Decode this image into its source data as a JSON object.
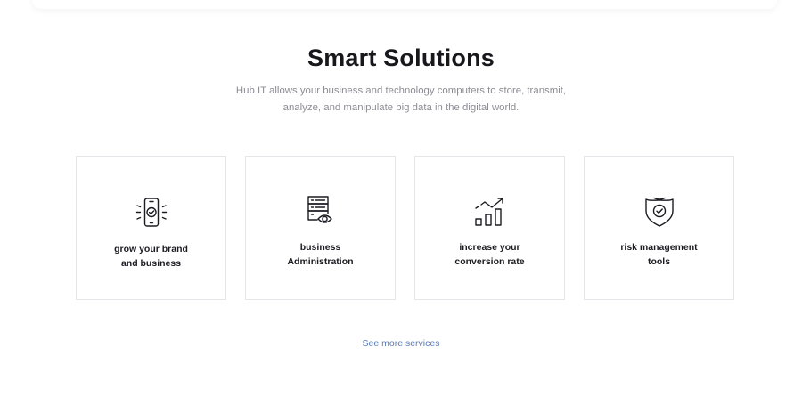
{
  "section": {
    "title": "Smart Solutions",
    "description_line1": "Hub IT allows your business and technology computers to store, transmit,",
    "description_line2": "analyze, and manipulate big data in the digital world."
  },
  "cards": [
    {
      "icon": "phone-check-icon",
      "label_line1": "grow your brand",
      "label_line2": "and business"
    },
    {
      "icon": "server-eye-icon",
      "label_line1": "business",
      "label_line2": "Administration"
    },
    {
      "icon": "growth-chart-icon",
      "label_line1": "increase your",
      "label_line2": "conversion rate"
    },
    {
      "icon": "shield-check-icon",
      "label_line1": "risk management",
      "label_line2": "tools"
    }
  ],
  "footer": {
    "see_more_label": "See more services",
    "link_color": "#5a7bb5"
  }
}
